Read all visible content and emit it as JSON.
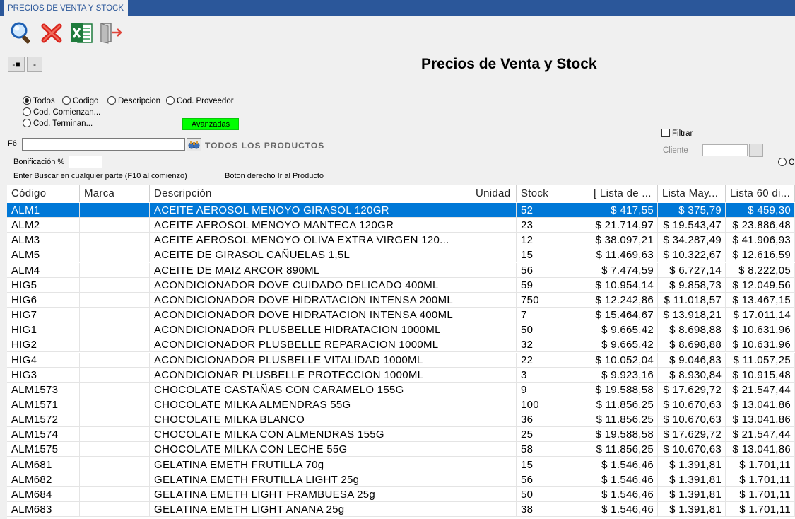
{
  "window": {
    "tab_label": "PRECIOS DE VENTA Y STOCK",
    "page_title": "Precios de Venta y Stock"
  },
  "toolbar": {
    "icons": [
      "search-icon",
      "delete-icon",
      "excel-icon",
      "exit-icon"
    ],
    "pin_label": "-■",
    "minus_label": "-"
  },
  "search_options": {
    "radios": [
      "Todos",
      "Codigo",
      "Descripcion",
      "Cod. Proveedor",
      "Cod. Comienzan...",
      "Cod. Terminan..."
    ],
    "selected": "Todos",
    "advanced_label": "Avanzadas",
    "search_key_label": "F6",
    "search_value": "",
    "all_products_label": "TODOS LOS PRODUCTOS",
    "bonificacion_label": "Bonificación %",
    "bonificacion_value": "",
    "hint_search": "Enter Buscar en cualquier parte (F10 al comienzo)",
    "hint_right_click": "Boton derecho Ir al Producto"
  },
  "filter": {
    "filtrar_label": "Filtrar",
    "cliente_label": "Cliente",
    "cliente_value": "",
    "partial_radio_label": "C"
  },
  "colors": {
    "accent": "#2b579a",
    "selection": "#0078d7",
    "advanced": "#00ff00"
  },
  "table": {
    "headers": [
      "Código",
      "Marca",
      "Descripción",
      "Unidad",
      "Stock",
      "[ Lista de ...",
      "Lista May...",
      "Lista 60 di..."
    ],
    "rows": [
      [
        "ALM1",
        "",
        "ACEITE AEROSOL MENOYO GIRASOL 120GR",
        "",
        "52",
        "$ 417,55",
        "$ 375,79",
        "$ 459,30"
      ],
      [
        "ALM2",
        "",
        "ACEITE AEROSOL MENOYO MANTECA 120GR",
        "",
        "23",
        "$ 21.714,97",
        "$ 19.543,47",
        "$ 23.886,48"
      ],
      [
        "ALM3",
        "",
        "ACEITE AEROSOL MENOYO OLIVA EXTRA VIRGEN 120...",
        "",
        "12",
        "$ 38.097,21",
        "$ 34.287,49",
        "$ 41.906,93"
      ],
      [
        "ALM5",
        "",
        "ACEITE DE GIRASOL CAÑUELAS 1,5L",
        "",
        "15",
        "$ 11.469,63",
        "$ 10.322,67",
        "$ 12.616,59"
      ],
      [
        "ALM4",
        "",
        "ACEITE DE MAIZ ARCOR 890ML",
        "",
        "56",
        "$ 7.474,59",
        "$ 6.727,14",
        "$ 8.222,05"
      ],
      [
        "HIG5",
        "",
        "ACONDICIONADOR DOVE CUIDADO DELICADO 400ML",
        "",
        "59",
        "$ 10.954,14",
        "$ 9.858,73",
        "$ 12.049,56"
      ],
      [
        "HIG6",
        "",
        "ACONDICIONADOR DOVE HIDRATACION INTENSA 200ML",
        "",
        "750",
        "$ 12.242,86",
        "$ 11.018,57",
        "$ 13.467,15"
      ],
      [
        "HIG7",
        "",
        "ACONDICIONADOR DOVE HIDRATACION INTENSA 400ML",
        "",
        "7",
        "$ 15.464,67",
        "$ 13.918,21",
        "$ 17.011,14"
      ],
      [
        "HIG1",
        "",
        "ACONDICIONADOR PLUSBELLE HIDRATACION 1000ML",
        "",
        "50",
        "$ 9.665,42",
        "$ 8.698,88",
        "$ 10.631,96"
      ],
      [
        "HIG2",
        "",
        "ACONDICIONADOR PLUSBELLE REPARACION 1000ML",
        "",
        "32",
        "$ 9.665,42",
        "$ 8.698,88",
        "$ 10.631,96"
      ],
      [
        "HIG4",
        "",
        "ACONDICIONADOR PLUSBELLE VITALIDAD 1000ML",
        "",
        "22",
        "$ 10.052,04",
        "$ 9.046,83",
        "$ 11.057,25"
      ],
      [
        "HIG3",
        "",
        "ACONDICIONAR PLUSBELLE PROTECCION 1000ML",
        "",
        "3",
        "$ 9.923,16",
        "$ 8.930,84",
        "$ 10.915,48"
      ],
      [
        "ALM1573",
        "",
        "CHOCOLATE CASTAÑAS CON CARAMELO 155G",
        "",
        "9",
        "$ 19.588,58",
        "$ 17.629,72",
        "$ 21.547,44"
      ],
      [
        "ALM1571",
        "",
        "CHOCOLATE MILKA ALMENDRAS 55G",
        "",
        "100",
        "$ 11.856,25",
        "$ 10.670,63",
        "$ 13.041,86"
      ],
      [
        "ALM1572",
        "",
        "CHOCOLATE MILKA BLANCO",
        "",
        "36",
        "$ 11.856,25",
        "$ 10.670,63",
        "$ 13.041,86"
      ],
      [
        "ALM1574",
        "",
        "CHOCOLATE MILKA CON ALMENDRAS 155G",
        "",
        "25",
        "$ 19.588,58",
        "$ 17.629,72",
        "$ 21.547,44"
      ],
      [
        "ALM1575",
        "",
        "CHOCOLATE MILKA CON LECHE 55G",
        "",
        "58",
        "$ 11.856,25",
        "$ 10.670,63",
        "$ 13.041,86"
      ],
      [
        "ALM681",
        "",
        "GELATINA EMETH FRUTILLA 70g",
        "",
        "15",
        "$ 1.546,46",
        "$ 1.391,81",
        "$ 1.701,11"
      ],
      [
        "ALM682",
        "",
        "GELATINA EMETH FRUTILLA LIGHT 25g",
        "",
        "56",
        "$ 1.546,46",
        "$ 1.391,81",
        "$ 1.701,11"
      ],
      [
        "ALM684",
        "",
        "GELATINA EMETH LIGHT  FRAMBUESA 25g",
        "",
        "50",
        "$ 1.546,46",
        "$ 1.391,81",
        "$ 1.701,11"
      ],
      [
        "ALM683",
        "",
        "GELATINA EMETH LIGHT ANANA 25g",
        "",
        "38",
        "$ 1.546,46",
        "$ 1.391,81",
        "$ 1.701,11"
      ]
    ],
    "selected_row": 0
  }
}
